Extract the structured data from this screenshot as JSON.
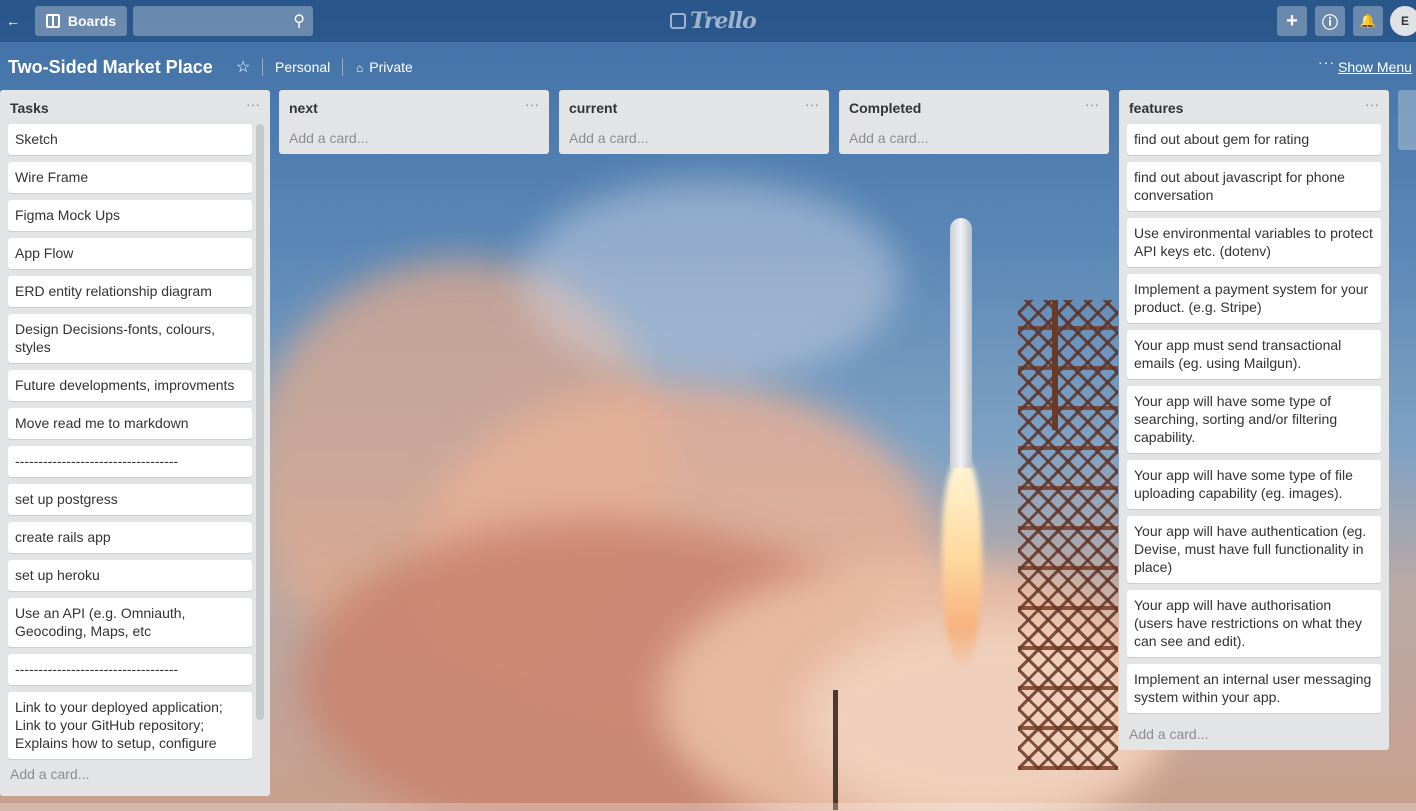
{
  "topbar": {
    "back_label": "←",
    "boards_label": "Boards",
    "search_placeholder": "",
    "logo_text": "Trello",
    "add_icon": "+",
    "info_icon": "ⓘ",
    "bell_icon": "🔔",
    "avatar_initial": "E"
  },
  "board": {
    "title": "Two-Sided Market Place",
    "star": "☆",
    "team": "Personal",
    "visibility": "Private",
    "show_menu": "Show Menu",
    "menu_dots": "···"
  },
  "lists": {
    "tasks": {
      "title": "Tasks",
      "cards": [
        "Sketch",
        "Wire Frame",
        "Figma Mock Ups",
        "App Flow",
        "ERD entity relationship diagram",
        "Design Decisions-fonts, colours, styles",
        "Future developments, improvments",
        "Move read me to markdown",
        "-----------------------------------",
        "set up postgress",
        "create rails app",
        "set up heroku",
        "Use an API (e.g. Omniauth, Geocoding, Maps, etc",
        "-----------------------------------",
        "Link to your deployed application; Link to your GitHub repository; Explains how to setup, configure"
      ],
      "add_card": "Add a card..."
    },
    "next": {
      "title": "next",
      "add_card": "Add a card..."
    },
    "current": {
      "title": "current",
      "add_card": "Add a card..."
    },
    "completed": {
      "title": "Completed",
      "add_card": "Add a card..."
    },
    "features": {
      "title": "features",
      "cards": [
        "find out about gem for rating",
        "find out about javascript for phone conversation",
        "Use environmental variables to protect API keys etc. (dotenv)",
        "Implement a payment system for your product. (e.g. Stripe)",
        "Your app must send transactional emails (eg. using Mailgun).",
        "Your app will have some type of searching, sorting and/or filtering capability.",
        "Your app will have some type of file uploading capability (eg. images).",
        "Your app will have authentication (eg. Devise, must have full functionality in place)",
        "Your app will have authorisation (users have restrictions on what they can see and edit).",
        "Implement an internal user messaging system within your app."
      ],
      "add_card": "Add a card..."
    }
  },
  "list_menu": "···"
}
